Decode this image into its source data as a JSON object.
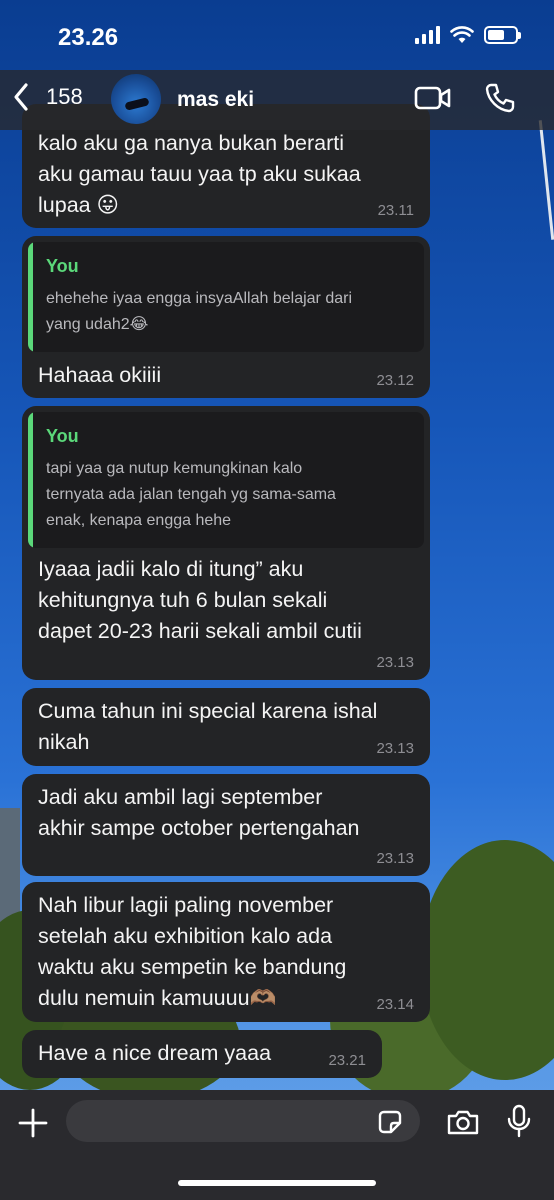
{
  "status": {
    "time": "23.26",
    "battery_level": 0.6
  },
  "header": {
    "back_count": "158",
    "contact_name": "mas eki"
  },
  "messages": [
    {
      "text": "kalo aku ga nanya bukan berarti\naku gamau tauu yaa tp aku sukaa\nlupaa 😛",
      "time": "23.11"
    },
    {
      "quote_author": "You",
      "quote_text": "ehehehe iyaa engga insyaAllah belajar dari\nyang udah2😂",
      "text": "Hahaaa okiiii",
      "time": "23.12"
    },
    {
      "quote_author": "You",
      "quote_text": "tapi yaa ga nutup kemungkinan kalo\nternyata ada jalan tengah yg sama-sama\nenak, kenapa engga hehe",
      "text": "Iyaaa jadii kalo di itung” aku\nkehitungnya tuh 6 bulan sekali\ndapet 20-23 harii sekali ambil cutii",
      "time": "23.13"
    },
    {
      "text": "Cuma tahun ini special karena ishal\nnikah",
      "time": "23.13"
    },
    {
      "text": "Jadi aku ambil lagi september\nakhir sampe october pertengahan",
      "time": "23.13"
    },
    {
      "text": "Nah libur lagii paling november\nsetelah aku exhibition kalo ada\nwaktu aku sempetin ke bandung\ndulu nemuin kamuuuu🫶🏽",
      "time": "23.14"
    },
    {
      "text": "Have a nice dream yaaa",
      "time": "23.21"
    }
  ],
  "composer": {
    "placeholder": ""
  },
  "colors": {
    "bubble": "#232426",
    "quote_accent": "#5bd87a",
    "timestamp": "#8e8e93"
  },
  "icons": [
    "chevron-left-icon",
    "video-camera-icon",
    "phone-icon",
    "plus-icon",
    "sticker-icon",
    "camera-icon",
    "microphone-icon",
    "signal-icon",
    "wifi-icon",
    "battery-icon"
  ]
}
